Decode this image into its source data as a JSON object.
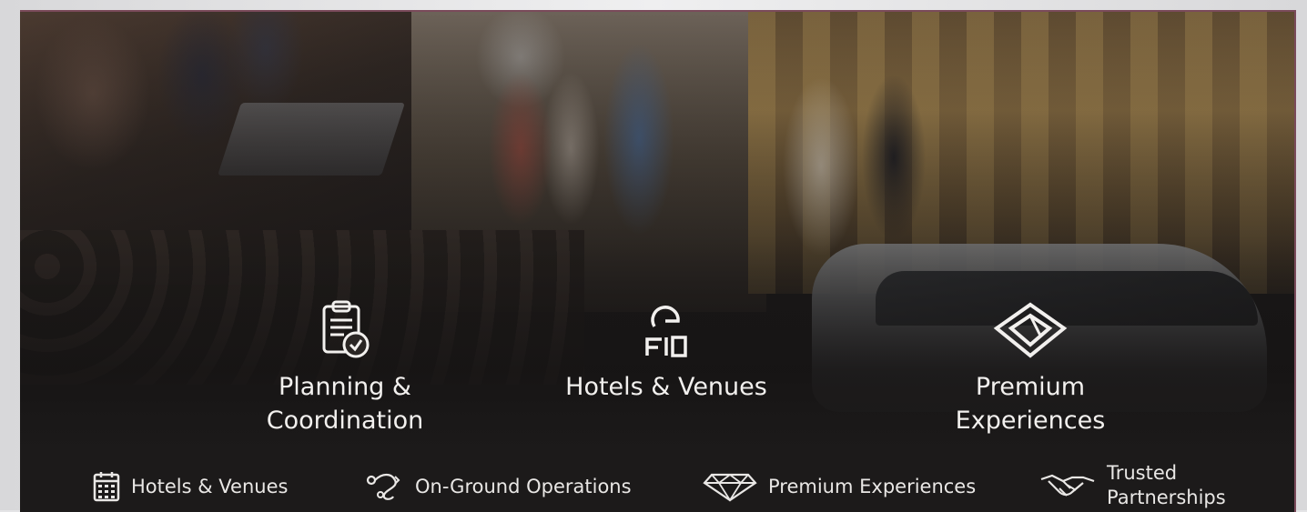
{
  "features": [
    {
      "title": "Planning &\nCoordination",
      "icon": "clipboard-check-icon"
    },
    {
      "title": "Hotels & Venues",
      "icon": "concierge-desk-icon"
    },
    {
      "title": "Premium\nExperiences",
      "icon": "diamond-emblem-icon"
    }
  ],
  "highlights": [
    {
      "label": "Hotels & Venues",
      "icon": "calendar-grid-icon"
    },
    {
      "label": "On-Ground Operations",
      "icon": "route-path-icon"
    },
    {
      "label": "Premium Experiences",
      "icon": "diamond-icon"
    },
    {
      "label": "Trusted\nPartnerships",
      "icon": "handshake-icon"
    }
  ],
  "colors": {
    "text": "#f2f0ee",
    "background": "#1c1a1a",
    "border": "#7a4a5a"
  }
}
